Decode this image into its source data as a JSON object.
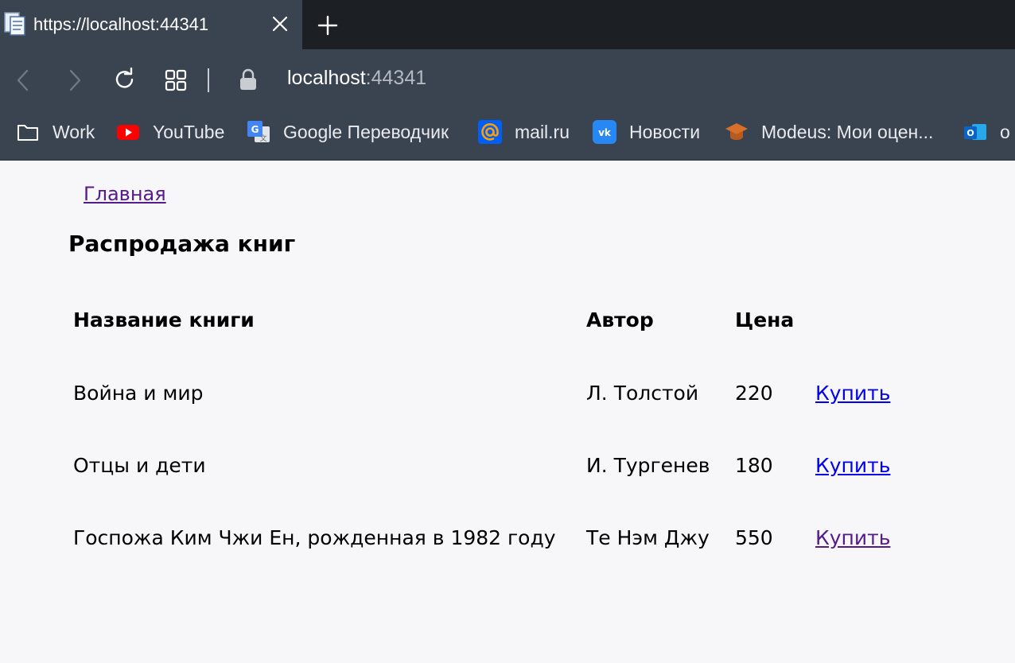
{
  "browser": {
    "tab_title": "https://localhost:44341",
    "url_host": "localhost",
    "url_port": ":44341",
    "bookmarks": [
      {
        "label": "Work",
        "icon": "folder-icon"
      },
      {
        "label": "YouTube",
        "icon": "youtube-icon"
      },
      {
        "label": "Google Переводчик",
        "icon": "google-translate-icon"
      },
      {
        "label": "mail.ru",
        "icon": "mailru-icon"
      },
      {
        "label": "Новости",
        "icon": "vk-icon"
      },
      {
        "label": "Modeus: Мои оцен...",
        "icon": "graduation-cap-icon"
      },
      {
        "label": "o",
        "icon": "outlook-icon"
      }
    ]
  },
  "page": {
    "home_link": "Главная",
    "title": "Распродажа книг",
    "columns": {
      "name": "Название книги",
      "author": "Автор",
      "price": "Цена"
    },
    "rows": [
      {
        "name": "Война и мир",
        "author": "Л. Толстой",
        "price": "220",
        "action": "Купить"
      },
      {
        "name": "Отцы и дети",
        "author": "И. Тургенев",
        "price": "180",
        "action": "Купить"
      },
      {
        "name": "Госпожа Ким Чжи Ен, рожденная в 1982 году",
        "author": "Те Нэм Джу",
        "price": "550",
        "action": "Купить"
      }
    ]
  },
  "colors": {
    "link_unvisited": "#0000ee",
    "link_visited": "#551a8b",
    "chrome_bg": "#3a4350",
    "tabstrip_bg": "#1c1f23",
    "page_bg": "#f7f7f9"
  }
}
